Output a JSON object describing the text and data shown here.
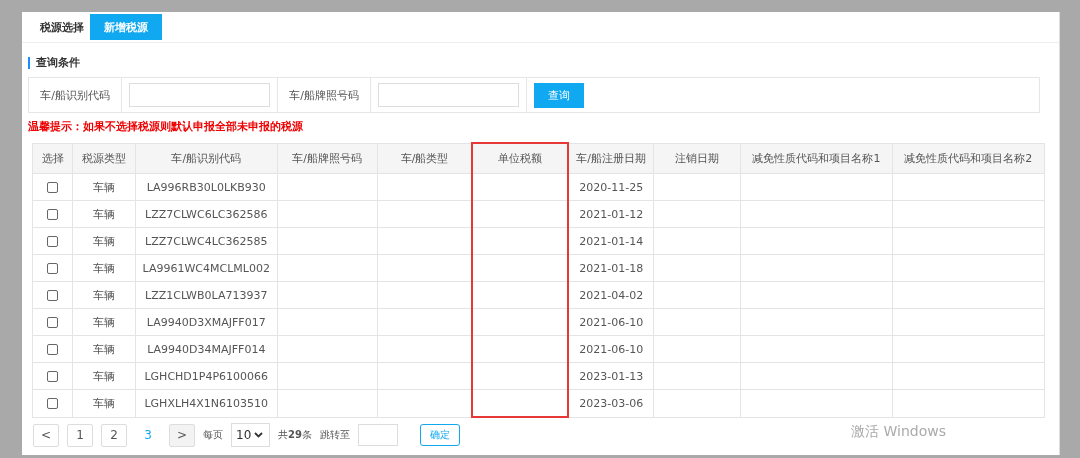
{
  "tabs": [
    {
      "label": "税源选择",
      "selected": false
    },
    {
      "label": "新增税源",
      "selected": true
    }
  ],
  "query": {
    "title": "查询条件",
    "fields": [
      {
        "label": "车/船识别代码"
      },
      {
        "label": "车/船牌照号码"
      }
    ],
    "button": "查询"
  },
  "warning": "温馨提示：如果不选择税源则默认申报全部未申报的税源",
  "table": {
    "columns": [
      {
        "label": "选择",
        "highlighted": false
      },
      {
        "label": "税源类型",
        "highlighted": false
      },
      {
        "label": "车/船识别代码",
        "highlighted": false
      },
      {
        "label": "车/船牌照号码",
        "highlighted": false
      },
      {
        "label": "车/船类型",
        "highlighted": false
      },
      {
        "label": "单位税额",
        "highlighted": true
      },
      {
        "label": "车/船注册日期",
        "highlighted": false
      },
      {
        "label": "注销日期",
        "highlighted": false
      },
      {
        "label": "减免性质代码和项目名称1",
        "highlighted": false
      },
      {
        "label": "减免性质代码和项目名称2",
        "highlighted": false
      }
    ],
    "rows": [
      {
        "checked": false,
        "type": "车辆",
        "vin": "LA996RB30L0LKB930",
        "reg_date": "2020-11-25"
      },
      {
        "checked": false,
        "type": "车辆",
        "vin": "LZZ7CLWC6LC362586",
        "reg_date": "2021-01-12"
      },
      {
        "checked": false,
        "type": "车辆",
        "vin": "LZZ7CLWC4LC362585",
        "reg_date": "2021-01-14"
      },
      {
        "checked": false,
        "type": "车辆",
        "vin": "LA9961WC4MCLML002",
        "reg_date": "2021-01-18"
      },
      {
        "checked": false,
        "type": "车辆",
        "vin": "LZZ1CLWB0LA713937",
        "reg_date": "2021-04-02"
      },
      {
        "checked": false,
        "type": "车辆",
        "vin": "LA9940D3XMAJFF017",
        "reg_date": "2021-06-10"
      },
      {
        "checked": false,
        "type": "车辆",
        "vin": "LA9940D34MAJFF014",
        "reg_date": "2021-06-10"
      },
      {
        "checked": false,
        "type": "车辆",
        "vin": "LGHCHD1P4P6100066",
        "reg_date": "2023-01-13"
      },
      {
        "checked": false,
        "type": "车辆",
        "vin": "LGHXLH4X1N6103510",
        "reg_date": "2023-03-06"
      }
    ]
  },
  "pagination": {
    "prev": "<",
    "pages": [
      {
        "label": "1",
        "selected": false
      },
      {
        "label": "2",
        "selected": false
      },
      {
        "label": "3",
        "selected": true
      }
    ],
    "next": ">",
    "per_page_label": "每页",
    "per_page": "10",
    "total": "共**29**条",
    "jump_label": "跳转至",
    "confirm": "确定"
  },
  "os_notice": "激活 Windows"
}
